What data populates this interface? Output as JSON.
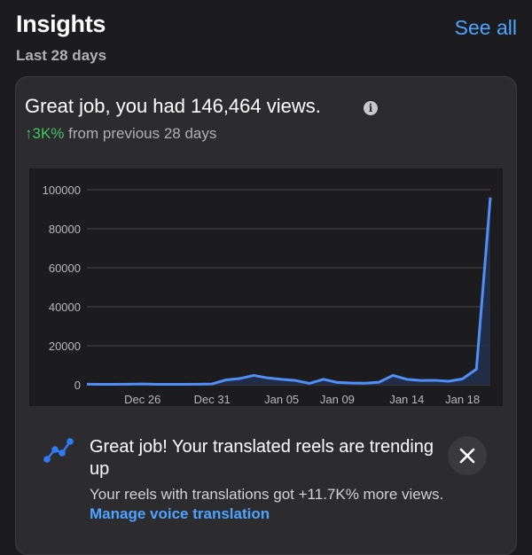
{
  "header": {
    "title": "Insights",
    "see_all_label": "See all",
    "period": "Last 28 days"
  },
  "card": {
    "headline": "Great job, you had 146,464 views.",
    "info_icon": "info-icon",
    "change_value": "↑3K%",
    "change_text": " from previous 28 days"
  },
  "colors": {
    "accent": "#4da3ff",
    "positive": "#43c463",
    "line": "#4f8ff7"
  },
  "chart_data": {
    "type": "area",
    "title": "",
    "xlabel": "",
    "ylabel": "",
    "ylim": [
      0,
      100000
    ],
    "yticks": [
      "100000",
      "80000",
      "60000",
      "40000",
      "20000",
      "0"
    ],
    "xticks": [
      "Dec 26",
      "Dec 31",
      "Jan 05",
      "Jan 09",
      "Jan 14",
      "Jan 18"
    ],
    "x": [
      "Dec 22",
      "Dec 23",
      "Dec 24",
      "Dec 25",
      "Dec 26",
      "Dec 27",
      "Dec 28",
      "Dec 29",
      "Dec 30",
      "Dec 31",
      "Jan 01",
      "Jan 02",
      "Jan 03",
      "Jan 04",
      "Jan 05",
      "Jan 06",
      "Jan 07",
      "Jan 08",
      "Jan 09",
      "Jan 10",
      "Jan 11",
      "Jan 12",
      "Jan 13",
      "Jan 14",
      "Jan 15",
      "Jan 16",
      "Jan 17",
      "Jan 18",
      "Jan 19"
    ],
    "series": [
      {
        "values": [
          300,
          200,
          200,
          300,
          400,
          200,
          200,
          200,
          300,
          400,
          2500,
          3200,
          4800,
          3500,
          2800,
          2200,
          700,
          2800,
          1200,
          900,
          800,
          1300,
          4800,
          2800,
          2200,
          2300,
          1800,
          3000,
          8000
        ]
      }
    ],
    "final_value": 96000,
    "grid": true
  },
  "notice": {
    "icon": "trending-up-icon",
    "title": "Great job! Your translated reels are trending up",
    "body": "Your reels with translations got +11.7K% more views. ",
    "link_label": "Manage voice translation",
    "close_icon": "close-icon"
  }
}
